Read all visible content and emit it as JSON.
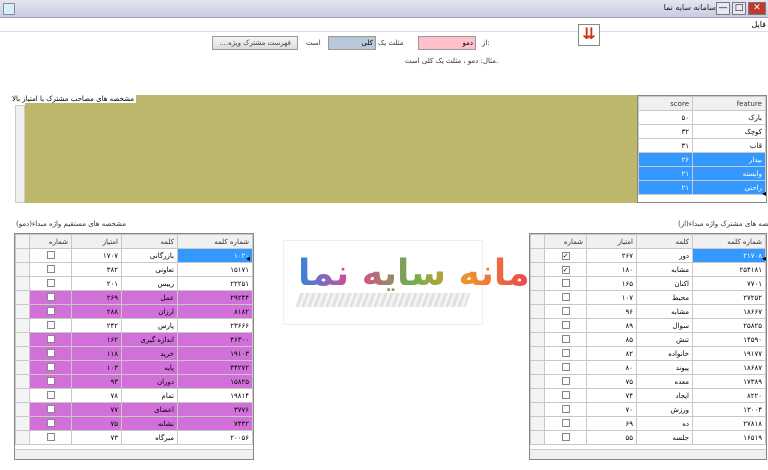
{
  "window": {
    "title": "سامانه سایه نما",
    "menu": "فایل",
    "buttons": {
      "minimize": "—",
      "maximize": "□",
      "close": "✕"
    }
  },
  "top_form": {
    "down_button_icon": "double-chevron-down-icon",
    "label_1": "از:",
    "input_1_value": "دمو",
    "label_2": "مثلث یک",
    "input_2_value": "کلی",
    "label_3": "است",
    "button_label": "....فهرست مشترک ویژه",
    "hint": "مثال: دمو ، مثلث یک کلی است."
  },
  "olive_panel": {
    "caption": "مشخصه های مصاحب مشترک با امتیاز بالا"
  },
  "feature_grid": {
    "columns": [
      "feature",
      "score"
    ],
    "rows": [
      {
        "feature": "بارک",
        "score": "۵۰",
        "style": ""
      },
      {
        "feature": "کوچک",
        "score": "۳۲",
        "style": ""
      },
      {
        "feature": "قاب",
        "score": "۳۱",
        "style": ""
      },
      {
        "feature": "بیدار",
        "score": "۲۶",
        "style": "blue"
      },
      {
        "feature": "وابسته",
        "score": "۲۱",
        "style": "blue"
      },
      {
        "feature": "راحتی",
        "score": "۲۱",
        "style": "blue"
      }
    ]
  },
  "left_grid": {
    "caption": "مشخصه های مستقیم واژه مبداء(دمو)",
    "columns": [
      "شماره",
      "امتیاز",
      "کلمه",
      "شماره کلمه"
    ],
    "rows": [
      {
        "id": "۱۰۲۰",
        "word": "بازرگانی",
        "score": "۱۷۰۷",
        "style": "",
        "id_cur": true
      },
      {
        "id": "۱۵۱۷۱",
        "word": "تعاونی",
        "score": "۳۸۲",
        "style": ""
      },
      {
        "id": "۲۲۲۵۱",
        "word": "رییس",
        "score": "۲۰۱",
        "style": ""
      },
      {
        "id": "۲۹۲۴۴",
        "word": "عمل",
        "score": "۲۶۹",
        "style": "purple"
      },
      {
        "id": "۸۱۸۲",
        "word": "ارزان",
        "score": "۲۸۸",
        "style": "purple"
      },
      {
        "id": "۲۳۶۶۶",
        "word": "پارس",
        "score": "۲۴۲",
        "style": ""
      },
      {
        "id": "۴۶۳۰۰",
        "word": "اندازه گیری",
        "score": "۱۶۲",
        "style": "purple"
      },
      {
        "id": "۱۹۱۰۳",
        "word": "خرید",
        "score": "۱۱۸",
        "style": "purple"
      },
      {
        "id": "۴۴۲۷۲",
        "word": "پایه",
        "score": "۱۰۳",
        "style": "purple"
      },
      {
        "id": "۱۵۸۲۵",
        "word": "دوران",
        "score": "۹۳",
        "style": "purple"
      },
      {
        "id": "۱۹۸۱۴",
        "word": "تمام",
        "score": "۷۸",
        "style": ""
      },
      {
        "id": "۳۷۷۶",
        "word": "اعضای",
        "score": "۷۷",
        "style": "purple"
      },
      {
        "id": "۷۴۴۲",
        "word": "نشانه",
        "score": "۷۵",
        "style": "purple"
      },
      {
        "id": "۲۰۰۵۶",
        "word": "مبرگاه",
        "score": "۷۳",
        "style": ""
      }
    ]
  },
  "right_grid": {
    "caption": "مشخصه های مشترک واژه مبداء(از)",
    "columns": [
      "شماره",
      "امتیاز",
      "کلمه",
      "شماره کلمه"
    ],
    "rows": [
      {
        "id": "۲۱۷۰۸",
        "word": "دور",
        "score": "۲۶۷",
        "checked": true,
        "id_cur": true
      },
      {
        "id": "۲۵۴۱۸۱",
        "word": "مشابه",
        "score": "۱۸۰",
        "checked": true
      },
      {
        "id": "۷۷۰۱",
        "word": "اکنان",
        "score": "۱۶۵",
        "checked": false
      },
      {
        "id": "۲۷۲۵۲",
        "word": "محیط",
        "score": "۱۰۷",
        "checked": false
      },
      {
        "id": "۱۸۶۶۷",
        "word": "مشابه",
        "score": "۹۶",
        "checked": false
      },
      {
        "id": "۲۵۸۲۵",
        "word": "سوال",
        "score": "۸۹",
        "checked": false
      },
      {
        "id": "۱۴۵۹۰",
        "word": "تنش",
        "score": "۸۵",
        "checked": false
      },
      {
        "id": "۱۹۱۷۷",
        "word": "خانواده",
        "score": "۸۲",
        "checked": false
      },
      {
        "id": "۱۸۶۸۷",
        "word": "پیوند",
        "score": "۸۰",
        "checked": false
      },
      {
        "id": "۱۷۳۸۹",
        "word": "معده",
        "score": "۷۵",
        "checked": false
      },
      {
        "id": "۸۲۲۰",
        "word": "ایجاد",
        "score": "۷۴",
        "checked": false
      },
      {
        "id": "۱۳۰۰۴",
        "word": "ورزش",
        "score": "۷۰",
        "checked": false
      },
      {
        "id": "۲۷۸۱۸",
        "word": "ده",
        "score": "۶۹",
        "checked": false
      },
      {
        "id": "۱۶۵۱۹",
        "word": "جلسه",
        "score": "۵۵",
        "checked": false
      }
    ]
  },
  "logo": {
    "text": "سامانه سایه نما"
  }
}
